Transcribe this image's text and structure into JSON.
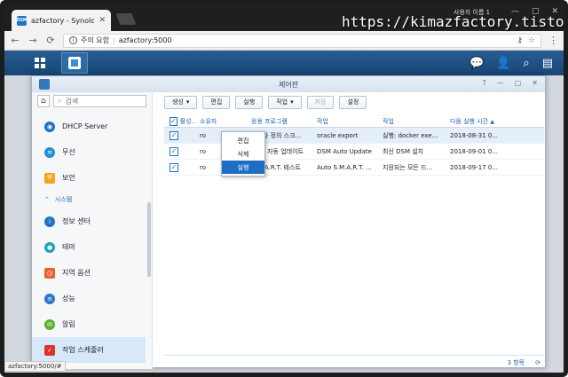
{
  "browser": {
    "tab_title": "azfactory - Synology Di",
    "tab_favicon": "DSM",
    "window_user": "사용자 이름 1",
    "watermark": "https://kimazfactory.tistory.com",
    "security_text": "주의 요함",
    "url": "azfactory:5000",
    "status_url": "azfactory:5000/#"
  },
  "window": {
    "title": "제어판",
    "actions": [
      "?",
      "—",
      "▢",
      "✕"
    ]
  },
  "sidebar": {
    "search_placeholder": "검색",
    "items": [
      {
        "label": "DHCP Server",
        "icon": "dhcp-icon",
        "color": "#1f6fc4"
      },
      {
        "label": "무선",
        "icon": "wifi-icon",
        "color": "#1f8fd6"
      },
      {
        "label": "보안",
        "icon": "shield-icon",
        "color": "#f2a51d"
      },
      {
        "label": "정보 센터",
        "icon": "info-icon",
        "color": "#1f73c5"
      },
      {
        "label": "테마",
        "icon": "palette-icon",
        "color": "#19a2b8"
      },
      {
        "label": "지역 옵션",
        "icon": "clock-icon",
        "color": "#e8632b"
      },
      {
        "label": "성능",
        "icon": "performance-icon",
        "color": "#2b78c6"
      },
      {
        "label": "알림",
        "icon": "chat-icon",
        "color": "#5dae2c"
      },
      {
        "label": "작업 스케줄러",
        "icon": "calendar-icon",
        "color": "#d9352b"
      }
    ],
    "section_label": "시스템"
  },
  "toolbar": {
    "create": "생성",
    "edit": "편집",
    "run": "실행",
    "action": "작업",
    "save": "저장",
    "settings": "설정"
  },
  "table": {
    "headers": [
      "활성...",
      "소유자",
      "응용 프로그램",
      "작업",
      "작업",
      "다음 실행 시간"
    ],
    "rows": [
      {
        "owner": "ro",
        "app": "사용자 정의 스크...",
        "task": "oracle export",
        "action": "실행: docker exe...",
        "next": "2018-08-31 0..."
      },
      {
        "owner": "ro",
        "app": "DSM 자동 업데이트",
        "task": "DSM Auto Update",
        "action": "최신 DSM 설치",
        "next": "2018-09-01 0..."
      },
      {
        "owner": "ro",
        "app": "S.M.A.R.T. 테스트",
        "task": "Auto S.M.A.R.T. ...",
        "action": "지원되는 모든 드...",
        "next": "2018-09-17 0..."
      }
    ],
    "count": "3 항목"
  },
  "context_menu": {
    "items": [
      "편집",
      "삭제",
      "실행"
    ],
    "highlighted": "실행"
  },
  "colors": {
    "accent": "#1f73c5",
    "taskbar": "#1a4f82"
  }
}
